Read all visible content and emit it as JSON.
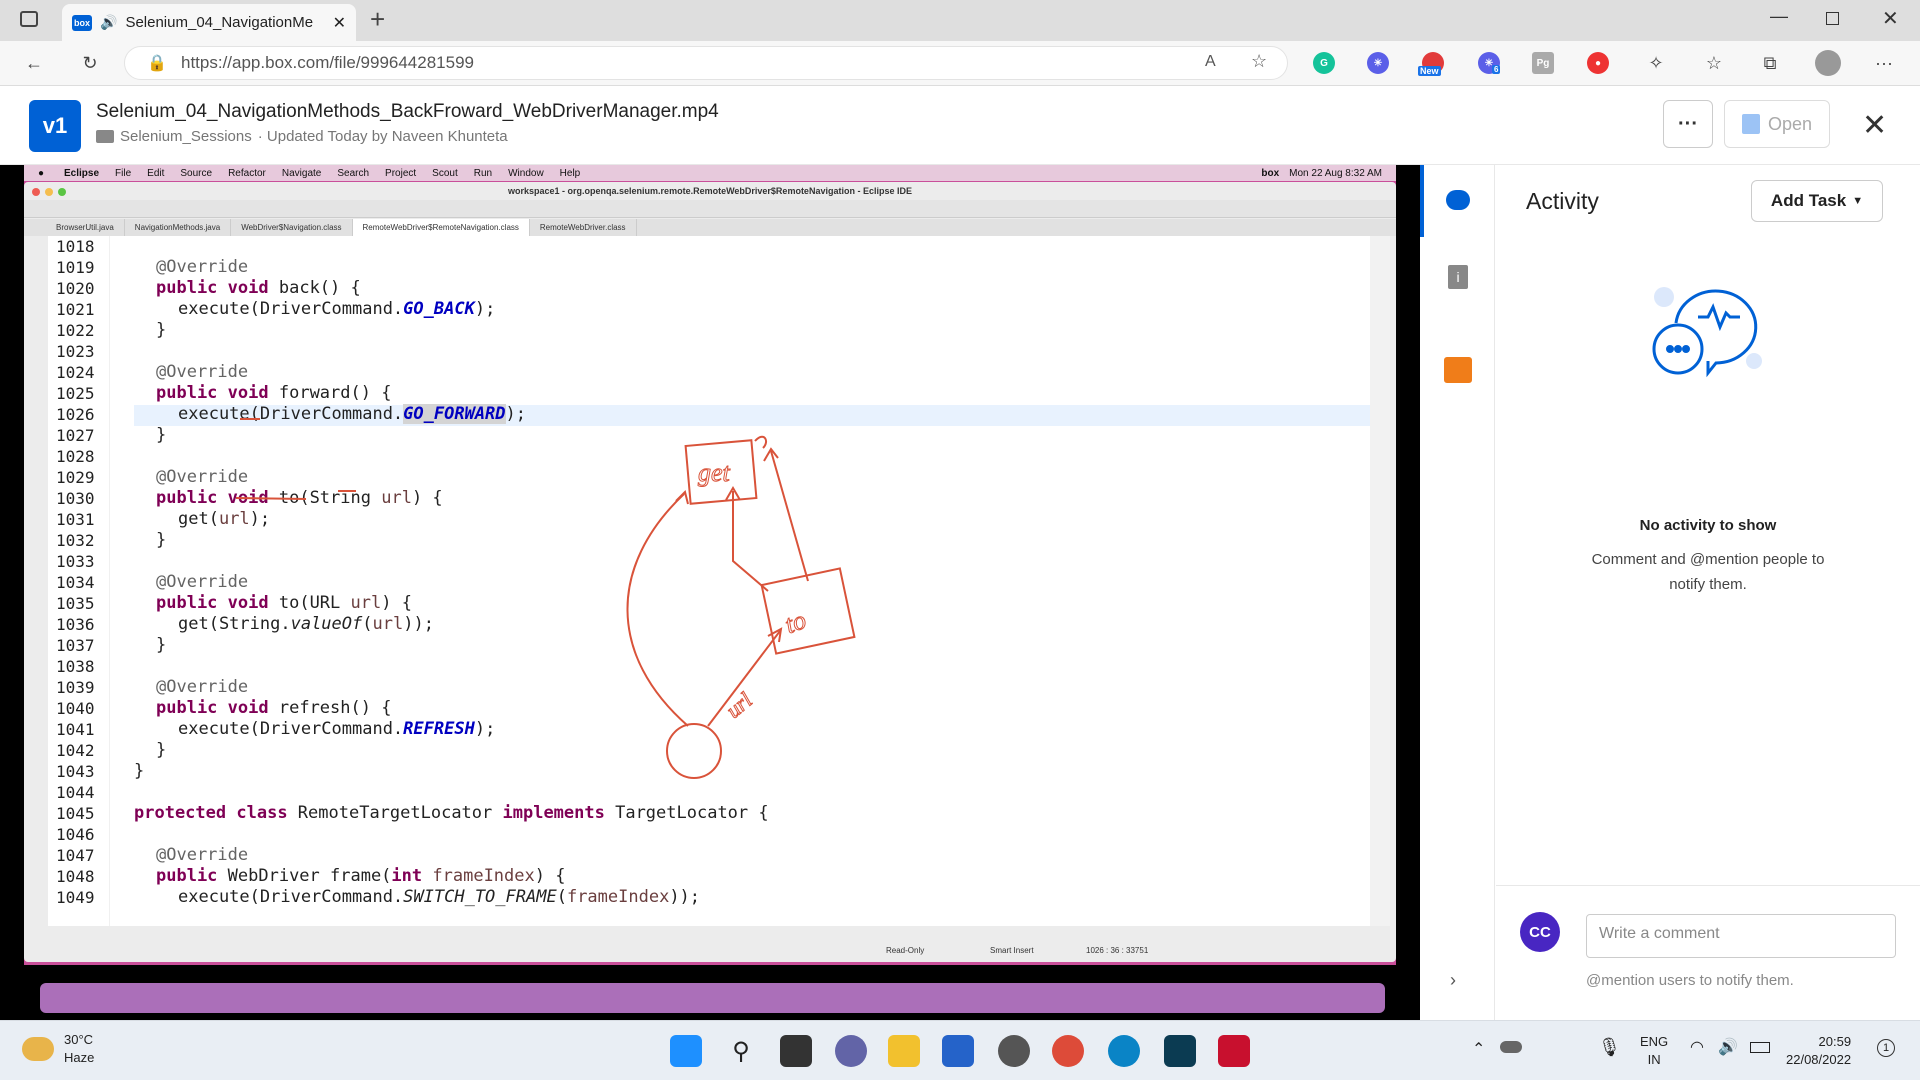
{
  "browser": {
    "tab_title": "Selenium_04_NavigationMe",
    "box_logo": "box",
    "url": "https://app.box.com/file/999644281599",
    "ext_new_badge": "New",
    "ext_count_badge": "6",
    "ext_pg_label": "Pg"
  },
  "box": {
    "version": "v1",
    "file_name": "Selenium_04_NavigationMethods_BackFroward_WebDriverManager.mp4",
    "folder": "Selenium_Sessions",
    "updated": "· Updated Today by Naveen Khunteta",
    "more_label": "···",
    "open_label": "Open",
    "close_label": "✕"
  },
  "mac": {
    "menu": [
      "Eclipse",
      "File",
      "Edit",
      "Source",
      "Refactor",
      "Navigate",
      "Search",
      "Project",
      "Scout",
      "Run",
      "Window",
      "Help"
    ],
    "menu_right": "Mon 22 Aug  8:32 AM",
    "menu_box": "box"
  },
  "eclipse": {
    "window_title": "workspace1 - org.openqa.selenium.remote.RemoteWebDriver$RemoteNavigation - Eclipse IDE",
    "tabs": [
      "BrowserUtil.java",
      "NavigationMethods.java",
      "WebDriver$Navigation.class",
      "RemoteWebDriver$RemoteNavigation.class",
      "RemoteWebDriver.class"
    ],
    "status": {
      "mode": "Read-Only",
      "insert": "Smart Insert",
      "position": "1026 : 36 : 33751"
    }
  },
  "code": {
    "line_numbers": [
      "1018",
      "1019",
      "1020",
      "1021",
      "1022",
      "1023",
      "1024",
      "1025",
      "1026",
      "1027",
      "1028",
      "1029",
      "1030",
      "1031",
      "1032",
      "1033",
      "1034",
      "1035",
      "1036",
      "1037",
      "1038",
      "1039",
      "1040",
      "1041",
      "1042",
      "1043",
      "1044",
      "1045",
      "1046",
      "1047",
      "1048",
      "1049"
    ],
    "override": "@Override",
    "public": "public",
    "void": "void",
    "protected": "protected",
    "class": "class",
    "implements": "implements",
    "int": "int",
    "back_sig": " back() {",
    "execute": "execute(DriverCommand.",
    "go_back": "GO_BACK",
    "go_forward": "GO_FORWARD",
    "refresh_const": "REFRESH",
    "close_paren": ");",
    "brace": "}",
    "forward_sig": " forward() {",
    "to_string_sig_a": " to(String ",
    "url": "url",
    "sig_end": ") {",
    "get_open": "get(",
    "to_url_sig_a": " to(URL ",
    "get_string": "get(String.",
    "valueof": "valueOf",
    "paren_open": "(",
    "double_close": "));",
    "refresh_sig": " refresh() {",
    "locator_name": " RemoteTargetLocator ",
    "target_locator": " TargetLocator {",
    "webdriver_frame": " WebDriver frame(",
    "frame_index": "frameIndex",
    "switch_frame": "SWITCH_TO_FRAME"
  },
  "annotations": {
    "get": "get",
    "to": "to",
    "url": "url"
  },
  "panel": {
    "title": "Activity",
    "add_task": "Add Task",
    "no_activity": "No activity to show",
    "no_activity_sub": "Comment and @mention people to notify them.",
    "avatar": "CC",
    "comment_placeholder": "Write a comment",
    "mention_hint": "@mention users to notify them."
  },
  "taskbar": {
    "temp": "30°C",
    "weather": "Haze",
    "lang": "ENG",
    "region": "IN",
    "time": "20:59",
    "date": "22/08/2022",
    "notif": "1"
  },
  "colors": {
    "box_blue": "#0061d5",
    "annotation_red": "#d9533a",
    "avatar_purple": "#4826c2"
  }
}
